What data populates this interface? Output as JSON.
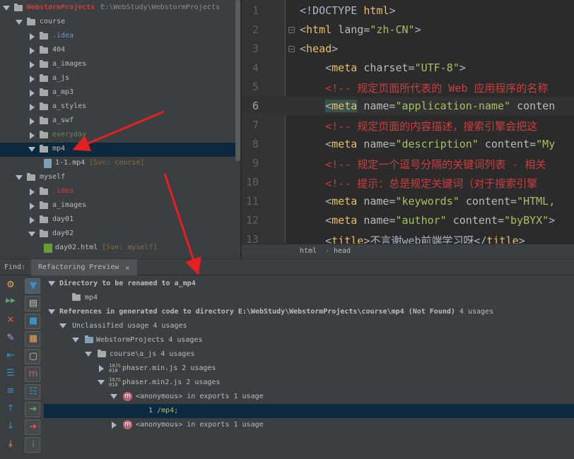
{
  "project_tree": {
    "root": {
      "name": "WebstormProjects",
      "path": "E:\\WebStudy\\WebstormProjects"
    },
    "items": [
      {
        "label": "course",
        "kind": "folder",
        "depth": 1,
        "expanded": true
      },
      {
        "label": ".idea",
        "kind": "folder",
        "depth": 2,
        "expanded": false,
        "color": "#6897bb"
      },
      {
        "label": "404",
        "kind": "folder",
        "depth": 2,
        "expanded": false
      },
      {
        "label": "a_images",
        "kind": "folder",
        "depth": 2,
        "expanded": false
      },
      {
        "label": "a_js",
        "kind": "folder",
        "depth": 2,
        "expanded": false
      },
      {
        "label": "a_mp3",
        "kind": "folder",
        "depth": 2,
        "expanded": false
      },
      {
        "label": "a_styles",
        "kind": "folder",
        "depth": 2,
        "expanded": false
      },
      {
        "label": "a_swf",
        "kind": "folder",
        "depth": 2,
        "expanded": false
      },
      {
        "label": "everyday",
        "kind": "folder",
        "depth": 2,
        "expanded": false,
        "color": "#6a8759"
      },
      {
        "label": "mp4",
        "kind": "folder",
        "depth": 2,
        "expanded": true,
        "selected": true
      },
      {
        "label": "1-1.mp4",
        "kind": "file",
        "depth": 3,
        "vcs": "[Svn: course]"
      },
      {
        "label": "myself",
        "kind": "folder",
        "depth": 1,
        "expanded": true
      },
      {
        "label": ".idea",
        "kind": "folder",
        "depth": 2,
        "expanded": false,
        "color": "#cc3e3e"
      },
      {
        "label": "a_images",
        "kind": "folder",
        "depth": 2,
        "expanded": false
      },
      {
        "label": "day01",
        "kind": "folder",
        "depth": 2,
        "expanded": false
      },
      {
        "label": "day02",
        "kind": "folder",
        "depth": 2,
        "expanded": true
      },
      {
        "label": "day02.html",
        "kind": "html",
        "depth": 3,
        "vcs": "[Svn: myself]"
      }
    ]
  },
  "editor": {
    "lines": [
      {
        "n": "1",
        "html": "<span class='tx'>&lt;!DOCTYPE </span><span class='tg'>html</span><span class='tx'>&gt;</span>"
      },
      {
        "n": "2",
        "html": "<span class='tx'>&lt;</span><span class='tg'>html </span><span class='at'>lang=</span><span class='vl'>\"zh-CN\"</span><span class='tx'>&gt;</span>"
      },
      {
        "n": "3",
        "html": "<span class='tx'>&lt;</span><span class='tg'>head</span><span class='tx'>&gt;</span>"
      },
      {
        "n": "4",
        "html": "&nbsp;&nbsp;&nbsp;&nbsp;<span class='tx'>&lt;</span><span class='tg'>meta </span><span class='at'>charset=</span><span class='vl'>\"UTF-8\"</span><span class='tx'>&gt;</span>"
      },
      {
        "n": "5",
        "html": "&nbsp;&nbsp;&nbsp;&nbsp;<span class='cm'>&lt;!-- 规定页面所代表的 Web 应用程序的名称</span>"
      },
      {
        "n": "6",
        "html": "&nbsp;&nbsp;&nbsp;&nbsp;<span class='tx tg-hl'>&lt;</span><span class='tg tg-hl'>meta</span><span class='tg'> </span><span class='at'>name=</span><span class='vl'>\"application-name\" </span><span class='at'>conten</span>"
      },
      {
        "n": "7",
        "html": "&nbsp;&nbsp;&nbsp;&nbsp;<span class='cm'>&lt;!-- 规定页面的内容描述，搜索引擎会把这</span>"
      },
      {
        "n": "8",
        "html": "&nbsp;&nbsp;&nbsp;&nbsp;<span class='tx'>&lt;</span><span class='tg'>meta </span><span class='at'>name=</span><span class='vl'>\"description\" </span><span class='at'>content=</span><span class='vl'>\"My</span>"
      },
      {
        "n": "9",
        "html": "&nbsp;&nbsp;&nbsp;&nbsp;<span class='cm'>&lt;!-- 规定一个逗号分隔的关键词列表 - 相关</span>"
      },
      {
        "n": "10",
        "html": "&nbsp;&nbsp;&nbsp;&nbsp;<span class='cm'>&lt;!-- 提示：总是规定关键词（对于搜索引擎</span>"
      },
      {
        "n": "11",
        "html": "&nbsp;&nbsp;&nbsp;&nbsp;<span class='tx'>&lt;</span><span class='tg'>meta </span><span class='at'>name=</span><span class='vl'>\"keywords\" </span><span class='at'>content=</span><span class='vl'>\"HTML,</span>"
      },
      {
        "n": "12",
        "html": "&nbsp;&nbsp;&nbsp;&nbsp;<span class='tx'>&lt;</span><span class='tg'>meta </span><span class='at'>name=</span><span class='vl'>\"author\" </span><span class='at'>content=</span><span class='vl'>\"byBYX\"</span><span class='tx'>&gt;</span>"
      },
      {
        "n": "13",
        "html": "&nbsp;&nbsp;&nbsp;&nbsp;<span class='tx'>&lt;</span><span class='tg'>title</span><span class='tx'>&gt;不言谢web前端学习呀&lt;/</span><span class='tg'>title</span><span class='tx'>&gt;</span>"
      }
    ],
    "breadcrumb": [
      "html",
      "head"
    ]
  },
  "find_panel": {
    "label": "Find:",
    "tab": "Refactoring Preview"
  },
  "results": {
    "dir_header": "Directory to be renamed to a_mp4",
    "dir_item": "mp4",
    "refs_header": "References in generated code to directory E:\\WebStudy\\WebstormProjects\\course\\mp4 (Not Found)",
    "refs_count": "4 usages",
    "unclassified": "Unclassified usage",
    "unclassified_count": "4 usages",
    "project": "WebstormProjects",
    "project_count": "4 usages",
    "folder": "course\\a_js",
    "folder_count": "4 usages",
    "file1": "phaser.min.js",
    "file1_count": "2 usages",
    "file2": "phaser.min2.js",
    "file2_count": "2 usages",
    "anon1": "<anonymous>",
    "anon1_suffix": "in exports",
    "anon1_count": "1 usage",
    "match_line": "1",
    "match_text": "/mp4;",
    "anon2": "<anonymous>",
    "anon2_suffix": "in exports",
    "anon2_count": "1 usage"
  },
  "toolbar": [
    {
      "name": "rerun-icon",
      "glyph": "⚙",
      "color": "#e8a85b"
    },
    {
      "name": "do-refactor-icon",
      "glyph": "▶▶",
      "color": "#59a869"
    },
    {
      "name": "cancel-icon",
      "glyph": "✕",
      "color": "#e05555"
    },
    {
      "name": "pin-icon",
      "glyph": "✎",
      "color": "#b99bf8"
    },
    {
      "name": "previous-icon",
      "glyph": "⇤",
      "color": "#3592c4"
    },
    {
      "name": "expand-all-icon",
      "glyph": "☰",
      "color": "#3592c4"
    },
    {
      "name": "collapse-all-icon",
      "glyph": "≡",
      "color": "#3592c4"
    },
    {
      "name": "up-icon",
      "glyph": "↑",
      "color": "#3592c4"
    },
    {
      "name": "down-icon",
      "glyph": "↓",
      "color": "#3592c4"
    },
    {
      "name": "export-icon",
      "glyph": "⤓",
      "color": "#e8a85b"
    }
  ],
  "toolbar2": [
    {
      "name": "filter-icon",
      "glyph": "▼",
      "color": "#3592c4",
      "active": true
    },
    {
      "name": "preview-icon",
      "glyph": "▤",
      "color": "#bbbbbb"
    },
    {
      "name": "group-module-icon",
      "glyph": "■",
      "color": "#3592c4"
    },
    {
      "name": "group-directory-icon",
      "glyph": "▦",
      "color": "#e8a85b"
    },
    {
      "name": "group-file-icon",
      "glyph": "▢",
      "color": "#bbbbbb"
    },
    {
      "name": "group-method-icon",
      "glyph": "m",
      "color": "#b56878"
    },
    {
      "name": "flatten-icon",
      "glyph": "☷",
      "color": "#3592c4"
    },
    {
      "name": "include-icon",
      "glyph": "➜",
      "color": "#59a869"
    },
    {
      "name": "exclude-icon",
      "glyph": "➜",
      "color": "#e05555"
    },
    {
      "name": "info-icon",
      "glyph": "i",
      "color": "#3592c4"
    }
  ]
}
